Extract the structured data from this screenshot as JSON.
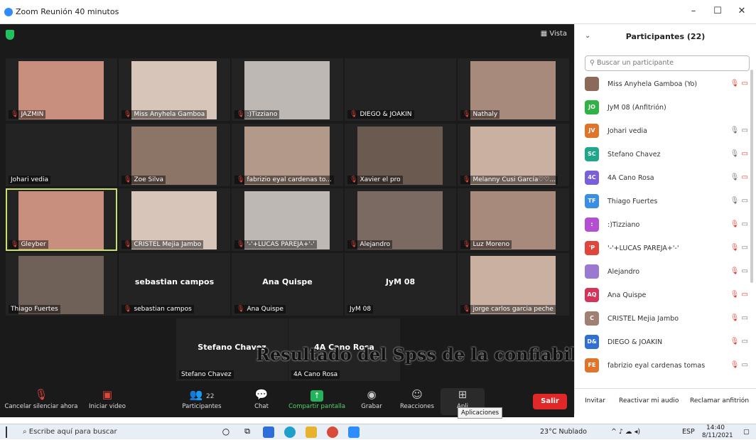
{
  "window": {
    "title": "Zoom Reunión 40 minutos",
    "minimize": "–",
    "maximize": "☐",
    "close": "✕"
  },
  "main": {
    "view_label": "Vista"
  },
  "tiles": [
    {
      "name": "JAZMIN",
      "muted": true,
      "video": true
    },
    {
      "name": "Miss Anyhela Gamboa",
      "muted": true,
      "video": true
    },
    {
      "name": ":)Tizziano",
      "muted": true,
      "video": true
    },
    {
      "name": "DIEGO & JOAKIN",
      "muted": true,
      "video": false
    },
    {
      "name": "Nathaly",
      "muted": true,
      "video": true
    },
    {
      "name": "Johari vedia",
      "muted": false,
      "video": false
    },
    {
      "name": "Zoe Silva",
      "muted": true,
      "video": true
    },
    {
      "name": "fabrizio eyal cardenas to...",
      "muted": true,
      "video": true
    },
    {
      "name": "Xavier el pro",
      "muted": true,
      "video": true
    },
    {
      "name": "Melanny Cusi García♡♡...",
      "muted": true,
      "video": true
    },
    {
      "name": "Gleyber",
      "muted": true,
      "video": true,
      "selected": true
    },
    {
      "name": "CRISTEL Mejia Jambo",
      "muted": true,
      "video": true
    },
    {
      "name": "'-'+LUCAS PAREJA+'-'",
      "muted": true,
      "video": true
    },
    {
      "name": "Alejandro",
      "muted": true,
      "video": true
    },
    {
      "name": "Luz Moreno",
      "muted": true,
      "video": true
    },
    {
      "name": "Thiago Fuertes",
      "muted": false,
      "video": true
    },
    {
      "name": "sebastian campos",
      "muted": true,
      "video": false,
      "big": "sebastian campos"
    },
    {
      "name": "Ana Quispe",
      "muted": true,
      "video": false,
      "big": "Ana Quispe"
    },
    {
      "name": "JyM 08",
      "muted": false,
      "video": false,
      "big": "JyM 08"
    },
    {
      "name": "jorge carlos garcia peche",
      "muted": true,
      "video": true
    },
    {
      "name": "Stefano Chavez",
      "muted": false,
      "video": false,
      "big": "Stefano Chavez"
    },
    {
      "name": "4A Cano Rosa",
      "muted": false,
      "video": false,
      "big": "4A Cano Rosa"
    }
  ],
  "overlay_text": "Resultado del Spss de la confiabilidad",
  "toolbar": {
    "unmute_label": "Cancelar silenciar ahora",
    "video_label": "Iniciar video",
    "participants_label": "Participantes",
    "participants_count": "22",
    "chat_label": "Chat",
    "share_label": "Compartir pantalla",
    "record_label": "Grabar",
    "reactions_label": "Reacciones",
    "apps_label": "Apli",
    "leave_label": "Salir",
    "tooltip": "Aplicaciones"
  },
  "panel": {
    "title": "Participantes (22)",
    "search_placeholder": "Buscar un participante",
    "participants": [
      {
        "initials": "",
        "name": "Miss Anyhela Gamboa (Yo)",
        "color": "#8b6a5a",
        "mic_off": true,
        "cam_off": true
      },
      {
        "initials": "JO",
        "name": "JyM 08 (Anfitrión)",
        "color": "#2fb344",
        "mic_off": false,
        "cam_off": false,
        "no_icons": true
      },
      {
        "initials": "JV",
        "name": "Johari vedia",
        "color": "#e0742a",
        "mic_off": false,
        "cam_off": false
      },
      {
        "initials": "SC",
        "name": "Stefano Chavez",
        "color": "#1ea78a",
        "mic_off": false,
        "cam_off": true
      },
      {
        "initials": "4C",
        "name": "4A Cano Rosa",
        "color": "#7b5fd6",
        "mic_off": false,
        "cam_off": true
      },
      {
        "initials": "TF",
        "name": "Thiago Fuertes",
        "color": "#3a8ee6",
        "mic_off": false,
        "cam_off": false
      },
      {
        "initials": ":",
        "name": ":)Tizziano",
        "color": "#b34fd1",
        "mic_off": true,
        "cam_off": false
      },
      {
        "initials": "'P",
        "name": "'-'+LUCAS PAREJA+'-'",
        "color": "#e0463b",
        "mic_off": true,
        "cam_off": false
      },
      {
        "initials": "",
        "name": "Alejandro",
        "color": "#9a7ad1",
        "mic_off": true,
        "cam_off": false
      },
      {
        "initials": "AQ",
        "name": "Ana Quispe",
        "color": "#d6335a",
        "mic_off": true,
        "cam_off": true
      },
      {
        "initials": "C",
        "name": "CRISTEL Mejia Jambo",
        "color": "#a08070",
        "mic_off": true,
        "cam_off": false
      },
      {
        "initials": "D&",
        "name": "DIEGO & JOAKIN",
        "color": "#2f6fd6",
        "mic_off": true,
        "cam_off": false
      },
      {
        "initials": "FE",
        "name": "fabrizio eyal cardenas tomas",
        "color": "#e0742a",
        "mic_off": true,
        "cam_off": false
      }
    ],
    "invite_label": "Invitar",
    "reactivate_label": "Reactivar mi audio",
    "claim_host_label": "Reclamar anfitrión"
  },
  "taskbar": {
    "search_text": "Escribe aquí para buscar",
    "weather": "23°C Nublado",
    "lang": "ESP",
    "time": "14:40",
    "date": "8/11/2021"
  }
}
